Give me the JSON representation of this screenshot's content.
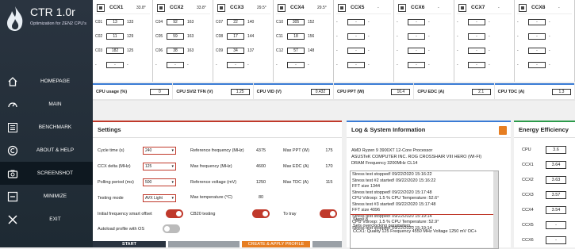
{
  "app": {
    "title": "CTR 1.0r",
    "subtitle": "Optimization for ZEN2 CPU's"
  },
  "nav": [
    {
      "label": "HOMEPAGE",
      "icon": "home-icon"
    },
    {
      "label": "MAIN",
      "icon": "gauge-icon"
    },
    {
      "label": "BENCHMARK",
      "icon": "list-icon"
    },
    {
      "label": "ABOUT & HELP",
      "icon": "copyright-icon"
    },
    {
      "label": "SCREENSHOT",
      "icon": "camera-icon"
    },
    {
      "label": "MINIMIZE",
      "icon": "minimize-icon"
    },
    {
      "label": "EXIT",
      "icon": "close-icon"
    }
  ],
  "ccx": [
    {
      "name": "CCX1",
      "temp": "33.8°",
      "rows": [
        {
          "c": "C01",
          "v": "13",
          "f": "133"
        },
        {
          "c": "C02",
          "v": "11",
          "f": "129"
        },
        {
          "c": "C03",
          "v": "182",
          "f": "125"
        },
        {
          "c": "-",
          "v": "-",
          "f": "-"
        }
      ]
    },
    {
      "name": "CCX2",
      "temp": "33.8°",
      "rows": [
        {
          "c": "C04",
          "v": "92",
          "f": "163"
        },
        {
          "c": "C05",
          "v": "59",
          "f": "163"
        },
        {
          "c": "C06",
          "v": "38",
          "f": "163"
        },
        {
          "c": "-",
          "v": "-",
          "f": "-"
        }
      ]
    },
    {
      "name": "CCX3",
      "temp": "29.5°",
      "rows": [
        {
          "c": "C07",
          "v": "22",
          "f": "140"
        },
        {
          "c": "C08",
          "v": "17",
          "f": "144"
        },
        {
          "c": "C09",
          "v": "34",
          "f": "137"
        },
        {
          "c": "-",
          "v": "-",
          "f": "-"
        }
      ]
    },
    {
      "name": "CCX4",
      "temp": "29.5°",
      "rows": [
        {
          "c": "C10",
          "v": "305",
          "f": "152"
        },
        {
          "c": "C11",
          "v": "18",
          "f": "156"
        },
        {
          "c": "C12",
          "v": "57",
          "f": "148"
        },
        {
          "c": "-",
          "v": "-",
          "f": "-"
        }
      ]
    },
    {
      "name": "CCX5",
      "temp": "-",
      "rows": [
        {
          "c": "-",
          "v": "-",
          "f": "-"
        },
        {
          "c": "-",
          "v": "-",
          "f": "-"
        },
        {
          "c": "-",
          "v": "-",
          "f": "-"
        },
        {
          "c": "-",
          "v": "-",
          "f": "-"
        }
      ]
    },
    {
      "name": "CCX6",
      "temp": "-",
      "rows": [
        {
          "c": "-",
          "v": "-",
          "f": "-"
        },
        {
          "c": "-",
          "v": "-",
          "f": "-"
        },
        {
          "c": "-",
          "v": "-",
          "f": "-"
        },
        {
          "c": "-",
          "v": "-",
          "f": "-"
        }
      ]
    },
    {
      "name": "CCX7",
      "temp": "-",
      "rows": [
        {
          "c": "-",
          "v": "-",
          "f": "-"
        },
        {
          "c": "-",
          "v": "-",
          "f": "-"
        },
        {
          "c": "-",
          "v": "-",
          "f": "-"
        },
        {
          "c": "-",
          "v": "-",
          "f": "-"
        }
      ]
    },
    {
      "name": "CCX8",
      "temp": "-",
      "rows": [
        {
          "c": "-",
          "v": "-",
          "f": "-"
        },
        {
          "c": "-",
          "v": "-",
          "f": "-"
        },
        {
          "c": "-",
          "v": "-",
          "f": "-"
        },
        {
          "c": "-",
          "v": "-",
          "f": "-"
        }
      ]
    }
  ],
  "metrics": [
    {
      "label": "CPU usage (%)",
      "value": "0"
    },
    {
      "label": "CPU SVI2 TFN (V)",
      "value": "1.25"
    },
    {
      "label": "CPU VID (V)",
      "value": "0.432"
    },
    {
      "label": "CPU PPT (W)",
      "value": "16.4"
    },
    {
      "label": "CPU EDC (A)",
      "value": "2.1"
    },
    {
      "label": "CPU TDC (A)",
      "value": "1.3"
    }
  ],
  "settings": {
    "title": "Settings",
    "cycle_time_label": "Cycle time (s)",
    "cycle_time": "240",
    "ccx_delta_label": "CCX delta (MHz)",
    "ccx_delta": "125",
    "polling_label": "Polling period (ms)",
    "polling": "500",
    "testing_mode_label": "Testing mode",
    "testing_mode": "AVX Light",
    "ref_freq_label": "Reference frequency (MHz)",
    "ref_freq": "4375",
    "max_freq_label": "Max frequency (MHz)",
    "max_freq": "4600",
    "ref_volt_label": "Reference voltage (mV)",
    "ref_volt": "1250",
    "max_temp_label": "Max temperature (°C)",
    "max_temp": "80",
    "max_ppt_label": "Max PPT (W)",
    "max_ppt": "175",
    "max_edc_label": "Max EDC (A)",
    "max_edc": "170",
    "max_tdc_label": "Max TDC (A)",
    "max_tdc": "115",
    "initial_smart_label": "Initial frequency smart offset",
    "cb20_label": "CB20 testing",
    "to_tray_label": "To tray",
    "autoload_label": "Autoload profile with OS",
    "start_label": "START",
    "create_label": "CREATE & APPLY PROFILE"
  },
  "log": {
    "title": "Log & System Information",
    "sys": [
      "AMD Ryzen 9 3900XT 12-Core Processor",
      "ASUSTeK COMPUTER INC. ROG CROSSHAIR VIII HERO (WI-FI)",
      "DRAM Frequency 3200MHz CL14"
    ],
    "lines": [
      "Stress test stopped! 09/22/2020 15:16:22",
      "Stress test #2 started! 09/22/2020 15:16:22",
      "FFT size 1344",
      "Stress test stopped! 09/22/2020 15:17:48",
      "CPU Vdroop: 1.5 % CPU Temperature: 52.6°",
      "Stress test #3 started! 09/22/2020 15:17:48",
      "FFT size 4096",
      "Stress test stopped! 09/22/2020 15:19:14",
      "CPU Vdroop: 1.5 % CPU Temperature: 52.9°",
      "Stress test stopped! 09/22/2020 15:19:14"
    ],
    "step": [
      "Step# 8",
      "Sets overclocking parameters...",
      "CCX1: Quality 125  Frequency 4550 MHz  Voltage 1250 mV  OC+"
    ]
  },
  "energy": {
    "title": "Energy Efficiency",
    "rows": [
      {
        "label": "CPU",
        "value": "3.6"
      },
      {
        "label": "CCX1",
        "value": "3.64"
      },
      {
        "label": "CCX2",
        "value": "3.63"
      },
      {
        "label": "CCX3",
        "value": "3.57"
      },
      {
        "label": "CCX4",
        "value": "3.54"
      },
      {
        "label": "CCX5",
        "value": "-"
      },
      {
        "label": "CCX6",
        "value": "-"
      }
    ]
  }
}
